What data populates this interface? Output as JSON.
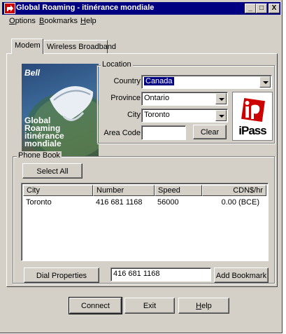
{
  "window": {
    "title": "Global Roaming - itinérance mondiale",
    "controls": [
      "_",
      "□",
      "X"
    ]
  },
  "menubar": {
    "items": [
      {
        "label_u": "O",
        "label_rest": "ptions"
      },
      {
        "label_u": "B",
        "label_rest": "ookmarks"
      },
      {
        "label_u": "H",
        "label_rest": "elp"
      }
    ]
  },
  "tabs": [
    {
      "label": "Modem",
      "active": true
    },
    {
      "label": "Wireless Broadband",
      "active": false
    }
  ],
  "brand_image": {
    "logo": "Bell",
    "lines": [
      "Global",
      "Roaming",
      "itinérance",
      "mondiale"
    ]
  },
  "location": {
    "group_label": "Location",
    "country_label": "Country",
    "country_value": "Canada",
    "province_label": "Province",
    "province_value": "Ontario",
    "city_label": "City",
    "city_value": "Toronto",
    "area_code_label": "Area Code",
    "area_code_value": "",
    "clear_button": "Clear"
  },
  "ipass_logo": {
    "text": "iPass"
  },
  "phonebook": {
    "group_label": "Phone Book",
    "select_all_button": "Select All",
    "columns": [
      "City",
      "Number",
      "Speed",
      "CDN$/hr"
    ],
    "rows": [
      {
        "city": "Toronto",
        "number": "416 681 1168",
        "speed": "56000",
        "cost": "0.00 (BCE)"
      }
    ],
    "dial_properties_button": "Dial Properties",
    "dial_number_value": "416 681 1168",
    "add_bookmark_button": "Add Bookmark"
  },
  "footer": {
    "connect_button": "Connect",
    "exit_button": "Exit",
    "help_button_u": "H",
    "help_button_rest": "elp"
  },
  "colors": {
    "title_bar": "#000080",
    "face": "#d4d0c8",
    "selection": "#000080",
    "ipass_red": "#cc0000"
  }
}
